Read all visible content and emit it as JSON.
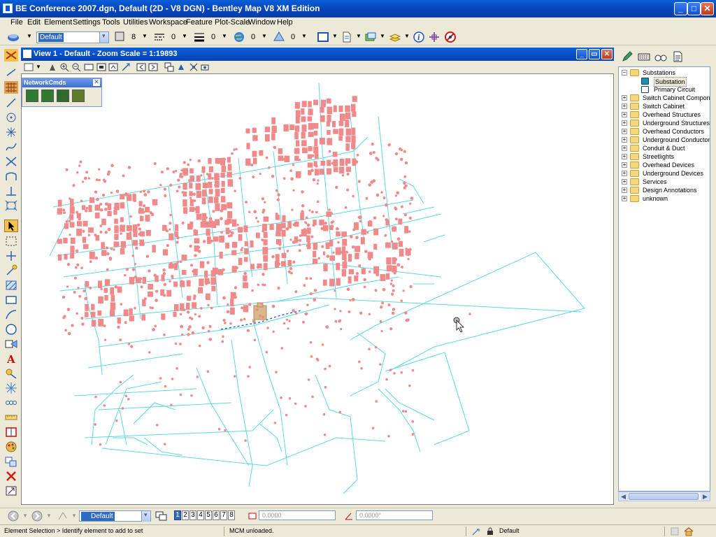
{
  "window": {
    "title": "BE Conference 2007.dgn, Default (2D - V8 DGN) - Bentley Map V8 XM Edition",
    "minimize": "_",
    "maximize": "□",
    "close": "✕"
  },
  "menu": [
    "File",
    "Edit",
    "Element",
    "Settings",
    "Tools",
    "Utilities",
    "Workspace",
    "Feature",
    "Plot-Scale",
    "Window",
    "Help"
  ],
  "main_toolbar": {
    "level_combo": "Default",
    "color_value": "8",
    "linestyle_value": "0",
    "weight_value": "0",
    "transparency_value": "0",
    "priority_value": "0"
  },
  "view": {
    "title": "View 1 - Default - Zoom Scale = 1:19893",
    "btn_minimize": "_",
    "btn_restore": "▭",
    "btn_close": "✕"
  },
  "palette": {
    "title": "NetworkCmds",
    "close": "✕"
  },
  "tree": {
    "items": [
      {
        "label": "Substations",
        "expander": "−",
        "type": "folder",
        "level": 0
      },
      {
        "label": "Substation",
        "expander": "",
        "type": "feature",
        "level": 1,
        "selected": true
      },
      {
        "label": "Primary Circuit",
        "expander": "",
        "type": "feature",
        "level": 1
      },
      {
        "label": "Switch Cabinet Compone",
        "expander": "+",
        "type": "folder",
        "level": 0
      },
      {
        "label": "Switch Cabinet",
        "expander": "+",
        "type": "folder",
        "level": 0
      },
      {
        "label": "Overhead Structures",
        "expander": "+",
        "type": "folder",
        "level": 0
      },
      {
        "label": "Underground Structures",
        "expander": "+",
        "type": "folder",
        "level": 0
      },
      {
        "label": "Overhead Conductors",
        "expander": "+",
        "type": "folder",
        "level": 0
      },
      {
        "label": "Underground Conductors",
        "expander": "+",
        "type": "folder",
        "level": 0
      },
      {
        "label": "Conduit & Duct",
        "expander": "+",
        "type": "folder",
        "level": 0
      },
      {
        "label": "Streetlights",
        "expander": "+",
        "type": "folder",
        "level": 0
      },
      {
        "label": "Overhead Devices",
        "expander": "+",
        "type": "folder",
        "level": 0
      },
      {
        "label": "Underground Devices",
        "expander": "+",
        "type": "folder",
        "level": 0
      },
      {
        "label": "Services",
        "expander": "+",
        "type": "folder",
        "level": 0
      },
      {
        "label": "Design Annotations",
        "expander": "+",
        "type": "folder",
        "level": 0
      },
      {
        "label": "unknown",
        "expander": "+",
        "type": "folder",
        "level": 0
      }
    ]
  },
  "bottom_toolbar": {
    "view_combo": "Default",
    "view_numbers": [
      "1",
      "2",
      "3",
      "4",
      "5",
      "6",
      "7",
      "8"
    ],
    "active_view": "1",
    "distance_value": "0.0000",
    "angle_value": "0.0000°"
  },
  "status": {
    "prompt": "Element Selection > Identify element to add to set",
    "message": "MCM unloaded.",
    "level": "Default"
  },
  "colors": {
    "map_lines": "#5ad8e6",
    "map_features": "#f08a8a",
    "substation": "#d8b888",
    "title_blue": "#0842B8"
  }
}
